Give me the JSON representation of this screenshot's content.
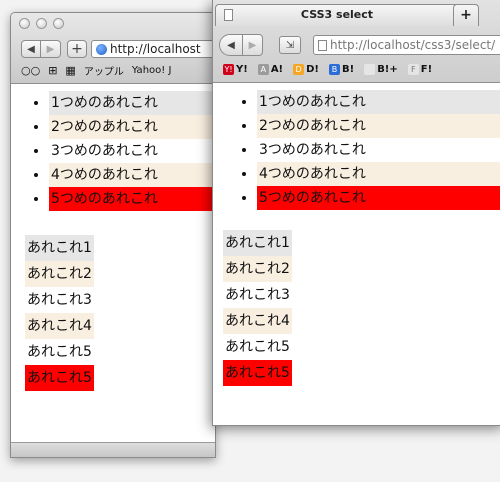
{
  "back_window": {
    "address": "http://localhost",
    "bookmarks": [
      "アップル",
      "Yahoo! J"
    ],
    "list_items": [
      {
        "text": "1つめのあれこれ",
        "bg": "#e6e6e6"
      },
      {
        "text": "2つめのあれこれ",
        "bg": "#f9efe1"
      },
      {
        "text": "3つめのあれこれ",
        "bg": "transparent"
      },
      {
        "text": "4つめのあれこれ",
        "bg": "#f9efe1"
      },
      {
        "text": "5つめのあれこれ",
        "bg": "#ff0000"
      }
    ],
    "paragraphs": [
      {
        "text": "あれこれ1",
        "bg": "#e6e6e6"
      },
      {
        "text": "あれこれ2",
        "bg": "#f9efe1"
      },
      {
        "text": "あれこれ3",
        "bg": "transparent"
      },
      {
        "text": "あれこれ4",
        "bg": "#f9efe1"
      },
      {
        "text": "あれこれ5",
        "bg": "transparent"
      },
      {
        "text": "あれこれ5",
        "bg": "#ff0000"
      }
    ]
  },
  "front_window": {
    "tab_title": "CSS3 select",
    "new_tab_label": "+",
    "address_host": "http://localhost",
    "address_path": "/css3/select/",
    "bookmarks": [
      {
        "label": "Y!",
        "icon_color": "#d0021b",
        "icon_text": "Y!"
      },
      {
        "label": "A!",
        "icon_color": "#9b9b9b",
        "icon_text": "A"
      },
      {
        "label": "D!",
        "icon_color": "#f5a623",
        "icon_text": "D"
      },
      {
        "label": "B!",
        "icon_color": "#2b6cd6",
        "icon_text": "B"
      },
      {
        "label": "B!+",
        "icon_color": "#e5e5e5",
        "icon_text": ""
      },
      {
        "label": "F!",
        "icon_color": "#e5e5e5",
        "icon_text": "F"
      }
    ],
    "list_items": [
      {
        "text": "1つめのあれこれ",
        "bg": "#e6e6e6"
      },
      {
        "text": "2つめのあれこれ",
        "bg": "#f9efe1"
      },
      {
        "text": "3つめのあれこれ",
        "bg": "transparent"
      },
      {
        "text": "4つめのあれこれ",
        "bg": "#f9efe1"
      },
      {
        "text": "5つめのあれこれ",
        "bg": "#ff0000"
      }
    ],
    "paragraphs": [
      {
        "text": "あれこれ1",
        "bg": "#e6e6e6"
      },
      {
        "text": "あれこれ2",
        "bg": "#f9efe1"
      },
      {
        "text": "あれこれ3",
        "bg": "transparent"
      },
      {
        "text": "あれこれ4",
        "bg": "#f9efe1"
      },
      {
        "text": "あれこれ5",
        "bg": "transparent"
      },
      {
        "text": "あれこれ5",
        "bg": "#ff0000"
      }
    ]
  }
}
